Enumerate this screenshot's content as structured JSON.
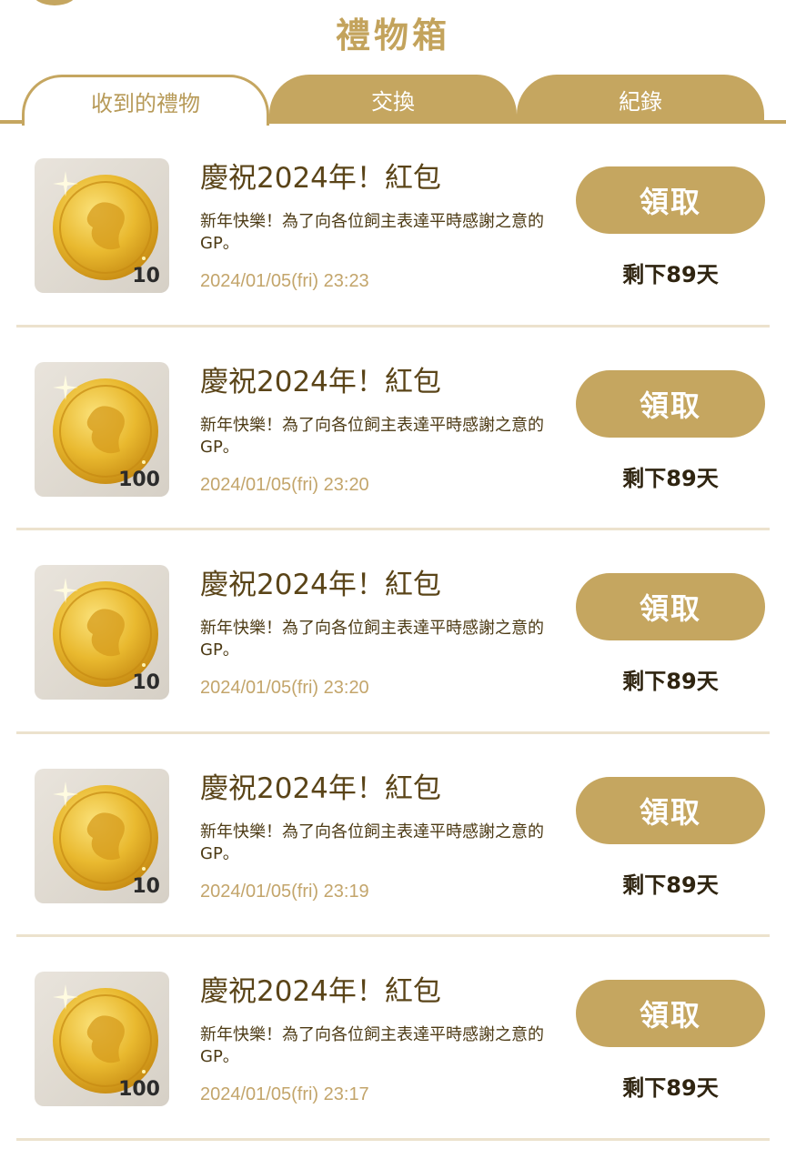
{
  "header": {
    "title": "禮物箱"
  },
  "tabs": [
    {
      "label": "收到的禮物",
      "active": true
    },
    {
      "label": "交換",
      "active": false
    },
    {
      "label": "紀錄",
      "active": false
    }
  ],
  "colors": {
    "accent": "#c5a660",
    "title_text": "#5a4418",
    "date_text": "#c3a56b"
  },
  "gifts": [
    {
      "icon": "gold-coin-icon",
      "count": "10",
      "title": "慶祝2024年！紅包",
      "description": "新年快樂！為了向各位飼主表達平時感謝之意的GP。",
      "date": "2024/01/05(fri) 23:23",
      "button": "領取",
      "remaining": "剩下89天"
    },
    {
      "icon": "gold-coin-icon",
      "count": "100",
      "title": "慶祝2024年！紅包",
      "description": "新年快樂！為了向各位飼主表達平時感謝之意的GP。",
      "date": "2024/01/05(fri) 23:20",
      "button": "領取",
      "remaining": "剩下89天"
    },
    {
      "icon": "gold-coin-icon",
      "count": "10",
      "title": "慶祝2024年！紅包",
      "description": "新年快樂！為了向各位飼主表達平時感謝之意的GP。",
      "date": "2024/01/05(fri) 23:20",
      "button": "領取",
      "remaining": "剩下89天"
    },
    {
      "icon": "gold-coin-icon",
      "count": "10",
      "title": "慶祝2024年！紅包",
      "description": "新年快樂！為了向各位飼主表達平時感謝之意的GP。",
      "date": "2024/01/05(fri) 23:19",
      "button": "領取",
      "remaining": "剩下89天"
    },
    {
      "icon": "gold-coin-icon",
      "count": "100",
      "title": "慶祝2024年！紅包",
      "description": "新年快樂！為了向各位飼主表達平時感謝之意的GP。",
      "date": "2024/01/05(fri) 23:17",
      "button": "領取",
      "remaining": "剩下89天"
    }
  ]
}
